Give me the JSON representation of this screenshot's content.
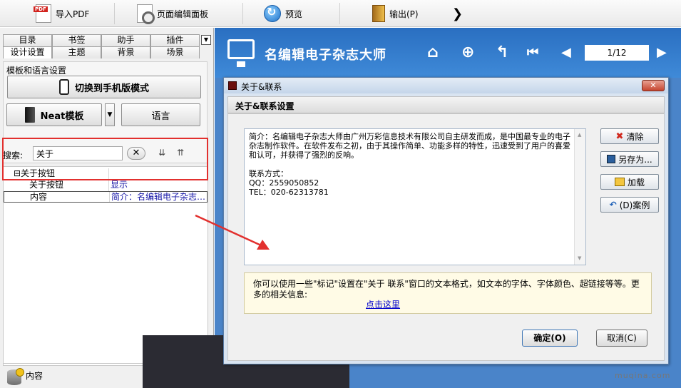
{
  "toolbar": {
    "import_pdf": "导入PDF",
    "page_editor": "页面编辑面板",
    "preview": "预览",
    "output": "输出(P)",
    "more": "❯"
  },
  "left": {
    "tabs_row1": [
      "目录",
      "书签",
      "助手",
      "插件"
    ],
    "tabs_row2": [
      "设计设置",
      "主题",
      "背景",
      "场景"
    ],
    "tab_menu_glyph": "▼",
    "section_title": "模板和语言设置",
    "switch_mobile": "切换到手机版模式",
    "neat_template": "Neat模板",
    "dropdown_glyph": "▼",
    "language": "语言",
    "search_label": "搜索:",
    "search_value": "关于",
    "clear_glyph": "✕",
    "tree": [
      {
        "col1": "⊟关于按钮",
        "col2": ""
      },
      {
        "col1": "关于按钮",
        "col2": "显示"
      },
      {
        "col1": "内容",
        "col2": "简介：名编辑电子杂志…"
      }
    ],
    "bottom_label": "内容"
  },
  "preview": {
    "brand": "名编辑电子杂志大师",
    "page_indicator": "1/12",
    "icons": {
      "home": "⌂",
      "zoom": "⊕",
      "back": "↰",
      "first": "⏮",
      "prev": "◀",
      "next": "▶"
    }
  },
  "dialog": {
    "title": "关于&联系",
    "close_glyph": "✕",
    "header": "关于&联系设置",
    "text_intro": "简介：名编辑电子杂志大师由广州万彩信息技术有限公司自主研发而成，是中国最专业的电子杂志制作软件。在软件发布之初，由于其操作简单、功能多样的特性，迅速受到了用户的喜爱和认可，并获得了强烈的反响。",
    "text_contact_title": "联系方式：",
    "text_qq": "QQ：2559050852",
    "text_tel": "TEL：020-62313781",
    "buttons": {
      "clear": "清除",
      "save_as": "另存为...",
      "load": "加载",
      "example": "(D)案例",
      "ok": "确定(O)",
      "cancel": "取消(C)"
    },
    "hint": "你可以使用一些\"标记\"设置在\"关于 联系\"窗口的文本格式，如文本的字体、字体颜色、超链接等等。更多的相关信息:",
    "hint_link": "点击这里"
  },
  "watermark": "muqina.com",
  "colors": {
    "highlight": "#e2302e",
    "brand_blue": "#2a6fc1",
    "link": "#0000cc"
  }
}
